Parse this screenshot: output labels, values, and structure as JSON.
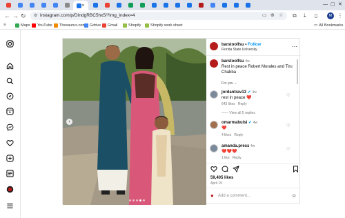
{
  "browser": {
    "url": "instagram.com/p/DIndgRBC5hx5/?img_index=4",
    "tab_favicon_colors": [
      "#ea4335",
      "#4285f4",
      "#4285f4",
      "#4285f4",
      "#4285f4",
      "#8a8a8a",
      "#1a73e8",
      "#1a73e8",
      "#ea4335",
      "#1a73e8",
      "#0f9d58",
      "#0f9d58",
      "#1a73e8",
      "#1a73e8",
      "#1a73e8",
      "#1a73e8",
      "#b31b1b",
      "#4285f4",
      "#1a73e8",
      "#1a73e8",
      "#1a73e8"
    ],
    "bookmarks": [
      {
        "label": "Maps",
        "color": "#34a853"
      },
      {
        "label": "YouTube",
        "color": "#ff0000"
      },
      {
        "label": "Thesaurus.com",
        "color": "#f28b00"
      },
      {
        "label": "Gdrive",
        "color": "#4285f4"
      },
      {
        "label": "Gmail",
        "color": "#ea4335"
      },
      {
        "label": "Shopify",
        "color": "#96bf48"
      },
      {
        "label": "Shopify work sheet",
        "color": "#96bf48"
      }
    ],
    "all_bookmarks": "All Bookmarks",
    "profile_initial": "M"
  },
  "post": {
    "author": "barstoolfsu",
    "follow": "Follow",
    "location": "Florida State University",
    "caption_author": "barstoolfsu",
    "caption_age": "4w",
    "caption": "Rest in peace Robert Morales and Tiru Chabba",
    "for_you": "For you",
    "comments": [
      {
        "user": "jordantrav13",
        "verified": true,
        "age": "4w",
        "text": "rest in peace",
        "heart": "❤️",
        "likes": "643 likes",
        "reply": "Reply",
        "view_replies": "View all 5 replies"
      },
      {
        "user": "omarmabulsi",
        "verified": true,
        "age": "4w",
        "text": "",
        "heart": "❤️",
        "likes": "4 likes",
        "reply": "Reply",
        "view_replies": ""
      },
      {
        "user": "amanda.press",
        "verified": false,
        "age": "4w",
        "text": "",
        "heart": "❤️❤️❤️",
        "likes": "1 like",
        "reply": "Reply",
        "view_replies": ""
      }
    ],
    "likes_count": "59,405 likes",
    "date": "April 19",
    "comment_placeholder": "Add a comment..."
  },
  "colors": {
    "accent_blue": "#0095f6",
    "verified_blue": "#0095f6",
    "heart_red": "#ed4956"
  }
}
